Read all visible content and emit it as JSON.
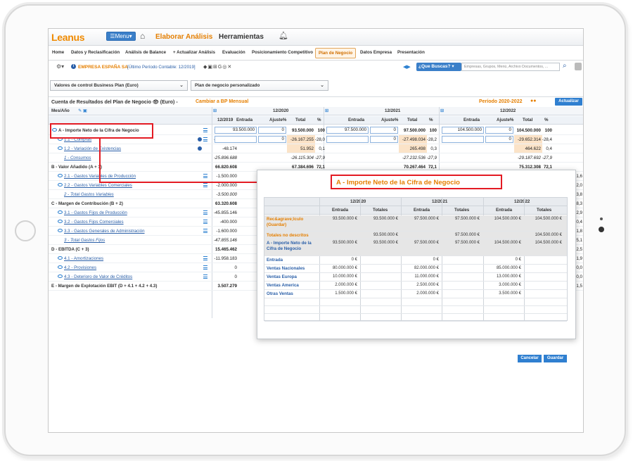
{
  "header": {
    "logo": "Leanus",
    "menu_label": "☰Menu▾",
    "nav_elaborar": "Elaborar Análisis",
    "nav_herramientas": "Herramientas"
  },
  "tabs": [
    {
      "label": "Home"
    },
    {
      "label": "Datos y Reclasificación"
    },
    {
      "label": "Análisis de Balance"
    },
    {
      "label": "+ Actualizar Análisis"
    },
    {
      "label": "Evaluación"
    },
    {
      "label": "Posicionamiento Competitivo"
    },
    {
      "label": "Plan de Negocio"
    },
    {
      "label": "Datos Empresa"
    },
    {
      "label": "Presentación"
    }
  ],
  "company": {
    "name": "EMPRESA ESPAÑA SA",
    "period_text": "[Último Período Contable: 12/2019]"
  },
  "search": {
    "label": "¿Que Buscas? ▾",
    "placeholder": "Empresas, Grupos, Menú, Archivo Documentos, ..."
  },
  "selectors": {
    "valores": "Valores de control Business Plan   (Euro)",
    "plan": "Plan de negocio personalizado"
  },
  "main": {
    "title": "Cuenta de Resultados del Plan de Negocio",
    "currency": "(Euro) -",
    "cambiar": "Cambiar a BP Mensual",
    "periodo": "Período 2020-2022",
    "actualizar": "Actualizar"
  },
  "grid": {
    "mes_ano": "Mes/Año",
    "col_2019": "12/2019",
    "years": [
      "12/2020",
      "12/2021",
      "12/2022"
    ],
    "sub_headers": [
      "Entrada",
      "Ajuste%",
      "Total",
      "%"
    ],
    "rows": [
      {
        "label": "A - Importe Neto de la Cifra de Negocio",
        "v2019": "92.717.296",
        "y": [
          [
            "93.500.000",
            "0",
            "93.500.000",
            "100"
          ],
          [
            "97.500.000",
            "0",
            "97.500.000",
            "100"
          ],
          [
            "104.500.000",
            "0",
            "104.500.000",
            "100"
          ]
        ]
      },
      {
        "label": "1.1 - Compras",
        "v2019": "-25.848.514",
        "y": [
          [
            "",
            "0",
            "-26.167.255",
            "-28,0"
          ],
          [
            "",
            "0",
            "-27.498.034",
            "-28,2"
          ],
          [
            "",
            "0",
            "-29.652.314",
            "-28,4"
          ]
        ]
      },
      {
        "label": "1.2 - Variación de Existencias",
        "v2019": "-48.174",
        "y": [
          [
            "",
            "",
            "51.952",
            "0,1"
          ],
          [
            "",
            "",
            "265.498",
            "0,3"
          ],
          [
            "",
            "",
            "464.622",
            "0,4"
          ]
        ]
      },
      {
        "label": "1 - Consumos",
        "v2019": "-25.896.688",
        "y": [
          [
            "",
            "",
            "-26.115.304",
            "-27,9"
          ],
          [
            "",
            "",
            "-27.232.536",
            "-27,9"
          ],
          [
            "",
            "",
            "-29.187.692",
            "-27,9"
          ]
        ]
      },
      {
        "label": "B - Valor Añadido (A + 1)",
        "v2019": "66.820.608",
        "y": [
          [
            "",
            "",
            "67.384.696",
            "72,1"
          ],
          [
            "",
            "",
            "70.267.464",
            "72,1"
          ],
          [
            "",
            "",
            "75.312.308",
            "72,1"
          ]
        ]
      },
      {
        "label": "2.1 - Gastos Variables de Producción",
        "v2019": "-1.500.000",
        "tail": "1,6"
      },
      {
        "label": "2.2 - Gastos Variables Comerciales",
        "v2019": "-2.000.000",
        "tail": "2,0"
      },
      {
        "label": "2 - Total Gastos Variables",
        "v2019": "-3.500.000",
        "tail": "3,8"
      },
      {
        "label": "C - Margen de Contribución (B + 2)",
        "v2019": "63.320.608",
        "tail": "8,3"
      },
      {
        "label": "3.1 - Gastos Fijos de Producción",
        "v2019": "-45.855.146",
        "tail": "2,9"
      },
      {
        "label": "3.2 - Gastos Fijos Comerciales",
        "v2019": "-400.000",
        "tail": "0,4"
      },
      {
        "label": "3.3 - Gastos Generales de Administración",
        "v2019": "-1.600.000",
        "tail": "1,8"
      },
      {
        "label": "3 - Total Gastos Fijos",
        "v2019": "-47.855.146",
        "tail": "5,1"
      },
      {
        "label": "D - EBITDA (C + 3)",
        "v2019": "15.465.462",
        "tail": "2,5"
      },
      {
        "label": "4.1 - Amortizaciones",
        "v2019": "-11.958.183",
        "tail": "1,9"
      },
      {
        "label": "4.2 - Provisiones",
        "v2019": "0",
        "tail": "0,0"
      },
      {
        "label": "4.3 - Deterioro de Valor de Créditos",
        "v2019": "0",
        "tail": "0,0"
      },
      {
        "label": "E - Margen de Explotación EBIT (D + 4.1 + 4.2 + 4.3)",
        "v2019": "3.507.279",
        "tail": "1,5"
      }
    ]
  },
  "modal": {
    "title": "A - Importe Neto de la Cifra de Negocio",
    "years": [
      "12/2020",
      "12/2021",
      "12/2022"
    ],
    "sub": [
      "Entrada",
      "Totales"
    ],
    "rows": [
      {
        "label": "Rec&agrave;lculo (Guardar)",
        "vals": [
          "93.500.000 €",
          "93.500.000 €",
          "97.500.000 €",
          "97.500.000 €",
          "104.500.000 €",
          "104.500.000 €"
        ]
      },
      {
        "label": "Totales no descritos",
        "vals": [
          "",
          "93.500.000 €",
          "",
          "97.500.000 €",
          "",
          "104.500.000 €"
        ]
      },
      {
        "label": "A - Importe Neto de la Cifra de Negocio",
        "vals": [
          "93.500.000 €",
          "93.500.000 €",
          "97.500.000 €",
          "97.500.000 €",
          "104.500.000 €",
          "104.500.000 €"
        ]
      },
      {
        "label": "Entrada",
        "vals": [
          "0 €",
          "",
          "0 €",
          "",
          "0 €",
          ""
        ]
      },
      {
        "label": "Ventas Nacionales",
        "vals": [
          "80.000.000 €",
          "",
          "82.000.000 €",
          "",
          "85.000.000 €",
          ""
        ]
      },
      {
        "label": "Ventas Europa",
        "vals": [
          "10.000.000 €",
          "",
          "11.000.000 €",
          "",
          "13.000.000 €",
          ""
        ]
      },
      {
        "label": "Ventas America",
        "vals": [
          "2.000.000 €",
          "",
          "2.500.000 €",
          "",
          "3.000.000 €",
          ""
        ]
      },
      {
        "label": "Otras Ventas",
        "vals": [
          "1.500.000 €",
          "",
          "2.000.000 €",
          "",
          "3.500.000 €",
          ""
        ]
      }
    ],
    "cancelar": "Cancelar",
    "guardar": "Guardar"
  },
  "colors": {
    "accent": "#e57f00",
    "link": "#2a5fa8",
    "button": "#2f7fd0",
    "annotation": "#e31b23"
  }
}
